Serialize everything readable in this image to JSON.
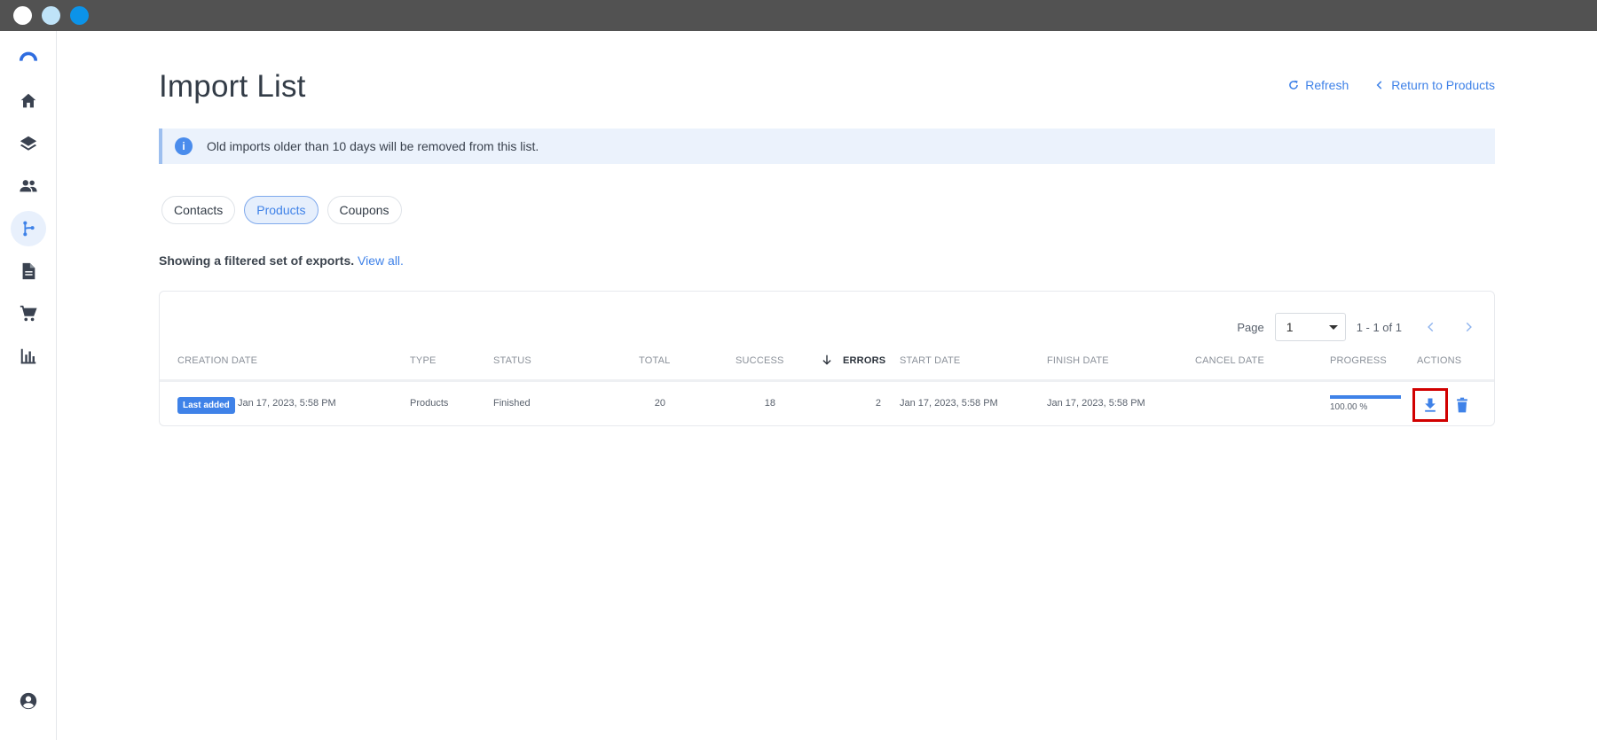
{
  "colors": {
    "accent": "#3f82e8",
    "highlight": "#d10000",
    "titlebar": "#525252"
  },
  "sidebar": {
    "items": [
      {
        "name": "logo",
        "icon": "arc-logo-icon"
      },
      {
        "name": "home",
        "icon": "home-icon"
      },
      {
        "name": "layers",
        "icon": "layers-icon"
      },
      {
        "name": "contacts",
        "icon": "people-icon"
      },
      {
        "name": "flows",
        "icon": "branch-icon",
        "active": true
      },
      {
        "name": "documents",
        "icon": "document-icon"
      },
      {
        "name": "cart",
        "icon": "cart-icon"
      },
      {
        "name": "reports",
        "icon": "bar-chart-icon"
      },
      {
        "name": "account",
        "icon": "user-circle-icon"
      }
    ]
  },
  "header": {
    "title": "Import List",
    "refresh_label": "Refresh",
    "return_label": "Return to Products"
  },
  "notice": {
    "text": "Old imports older than 10 days will be removed from this list."
  },
  "tabs": [
    {
      "label": "Contacts",
      "active": false
    },
    {
      "label": "Products",
      "active": true
    },
    {
      "label": "Coupons",
      "active": false
    }
  ],
  "filter": {
    "text": "Showing a filtered set of exports.",
    "link": "View all."
  },
  "pagination": {
    "label": "Page",
    "selected": "1",
    "range": "1 - 1 of 1"
  },
  "table": {
    "columns": {
      "creation_date": "CREATION DATE",
      "type": "TYPE",
      "status": "STATUS",
      "total": "TOTAL",
      "success": "SUCCESS",
      "errors": "ERRORS",
      "start_date": "START DATE",
      "finish_date": "FINISH DATE",
      "cancel_date": "CANCEL DATE",
      "progress": "PROGRESS",
      "actions": "ACTIONS"
    },
    "sorted_by": "errors",
    "rows": [
      {
        "badge": "Last added",
        "creation_date": "Jan 17, 2023, 5:58 PM",
        "type": "Products",
        "status": "Finished",
        "total": "20",
        "success": "18",
        "errors": "2",
        "start_date": "Jan 17, 2023, 5:58 PM",
        "finish_date": "Jan 17, 2023, 5:58 PM",
        "cancel_date": "",
        "progress_value": 1.0,
        "progress_label": "100.00 %",
        "actions": {
          "download_icon": "download-icon",
          "delete_icon": "trash-icon"
        }
      }
    ]
  }
}
